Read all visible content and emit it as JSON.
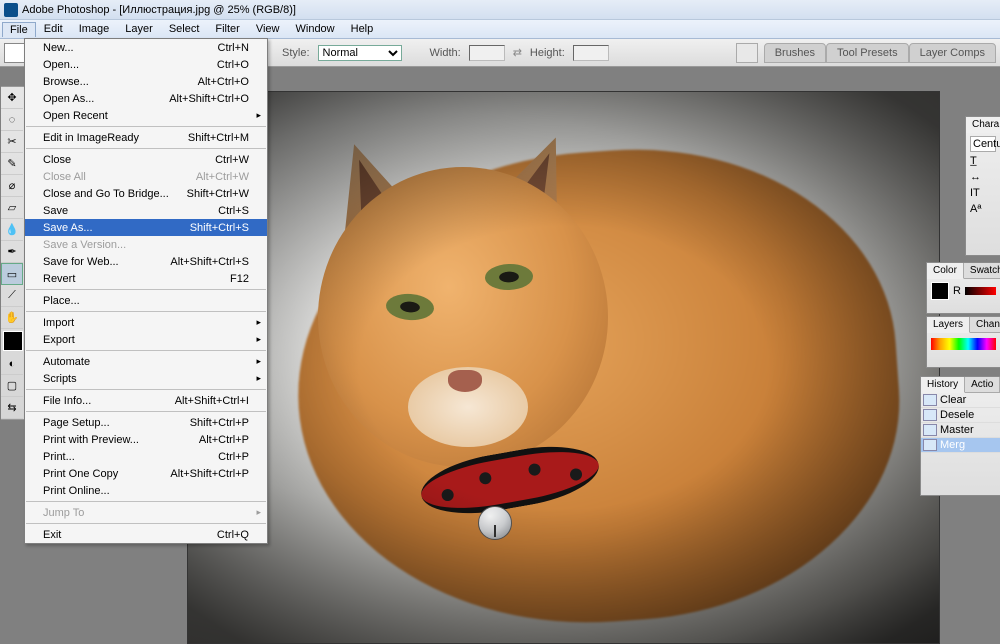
{
  "titlebar": {
    "app": "Adobe Photoshop",
    "doc": "[Иллюстрация.jpg @ 25% (RGB/8)]"
  },
  "menubar": [
    "File",
    "Edit",
    "Image",
    "Layer",
    "Select",
    "Filter",
    "View",
    "Window",
    "Help"
  ],
  "file_menu": [
    [
      {
        "l": "New...",
        "s": "Ctrl+N"
      },
      {
        "l": "Open...",
        "s": "Ctrl+O"
      },
      {
        "l": "Browse...",
        "s": "Alt+Ctrl+O"
      },
      {
        "l": "Open As...",
        "s": "Alt+Shift+Ctrl+O"
      },
      {
        "l": "Open Recent",
        "sub": true
      }
    ],
    [
      {
        "l": "Edit in ImageReady",
        "s": "Shift+Ctrl+M"
      }
    ],
    [
      {
        "l": "Close",
        "s": "Ctrl+W"
      },
      {
        "l": "Close All",
        "s": "Alt+Ctrl+W",
        "d": true
      },
      {
        "l": "Close and Go To Bridge...",
        "s": "Shift+Ctrl+W"
      },
      {
        "l": "Save",
        "s": "Ctrl+S"
      },
      {
        "l": "Save As...",
        "s": "Shift+Ctrl+S",
        "sel": true
      },
      {
        "l": "Save a Version...",
        "d": true
      },
      {
        "l": "Save for Web...",
        "s": "Alt+Shift+Ctrl+S"
      },
      {
        "l": "Revert",
        "s": "F12"
      }
    ],
    [
      {
        "l": "Place..."
      }
    ],
    [
      {
        "l": "Import",
        "sub": true
      },
      {
        "l": "Export",
        "sub": true
      }
    ],
    [
      {
        "l": "Automate",
        "sub": true
      },
      {
        "l": "Scripts",
        "sub": true
      }
    ],
    [
      {
        "l": "File Info...",
        "s": "Alt+Shift+Ctrl+I"
      }
    ],
    [
      {
        "l": "Page Setup...",
        "s": "Shift+Ctrl+P"
      },
      {
        "l": "Print with Preview...",
        "s": "Alt+Ctrl+P"
      },
      {
        "l": "Print...",
        "s": "Ctrl+P"
      },
      {
        "l": "Print One Copy",
        "s": "Alt+Shift+Ctrl+P"
      },
      {
        "l": "Print Online..."
      }
    ],
    [
      {
        "l": "Jump To",
        "sub": true,
        "d": true
      }
    ],
    [
      {
        "l": "Exit",
        "s": "Ctrl+Q"
      }
    ]
  ],
  "options": {
    "style_label": "Style:",
    "style_value": "Normal",
    "width_label": "Width:",
    "height_label": "Height:",
    "tabs": [
      "Brushes",
      "Tool Presets",
      "Layer Comps"
    ]
  },
  "char_panel": {
    "tab1": "Chara",
    "font": "Centu"
  },
  "color_panel": {
    "tab1": "Color",
    "tab2": "Swatch",
    "channel": "R"
  },
  "layers_panel": {
    "tab1": "Layers",
    "tab2": "Channe"
  },
  "history_panel": {
    "tab1": "History",
    "tab2": "Actio",
    "items": [
      "Clear",
      "Desele",
      "Master",
      "Merg"
    ]
  }
}
